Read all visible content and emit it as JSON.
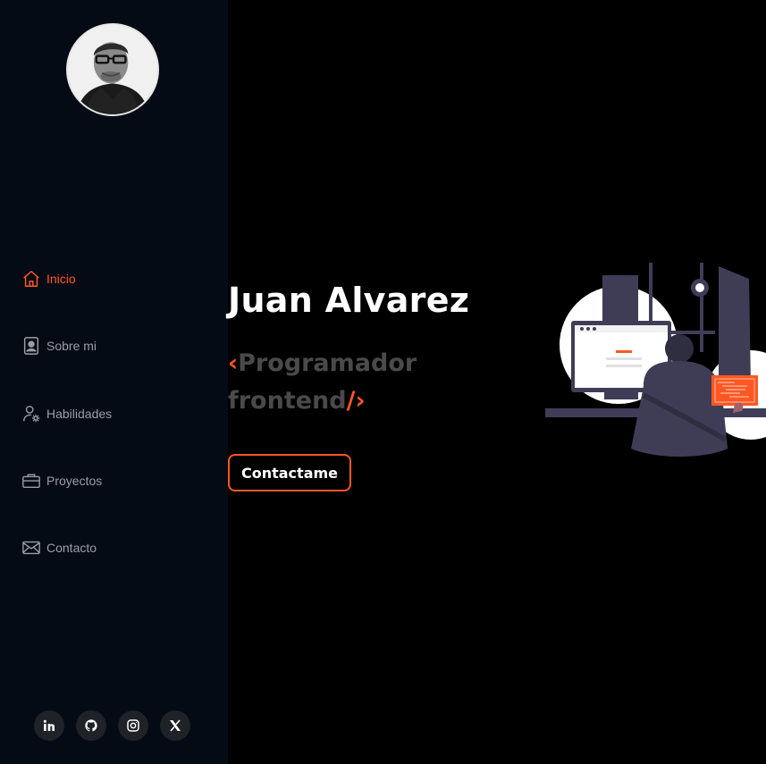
{
  "profile": {
    "avatar_alt": "Juan Alvarez"
  },
  "nav": {
    "items": [
      {
        "label": "Inicio",
        "icon": "home-icon",
        "active": true
      },
      {
        "label": "Sobre mi",
        "icon": "contact-card-icon",
        "active": false
      },
      {
        "label": "Habilidades",
        "icon": "user-gear-icon",
        "active": false
      },
      {
        "label": "Proyectos",
        "icon": "briefcase-icon",
        "active": false
      },
      {
        "label": "Contacto",
        "icon": "envelope-icon",
        "active": false
      }
    ]
  },
  "hero": {
    "name": "Juan Alvarez",
    "role_open": "‹",
    "role_text": "Programador frontend",
    "role_slash": "/",
    "role_close": "›",
    "cta_label": "Contactame"
  },
  "socials": [
    {
      "name": "LinkedIn",
      "icon": "linkedin-icon"
    },
    {
      "name": "GitHub",
      "icon": "github-icon"
    },
    {
      "name": "Instagram",
      "icon": "instagram-icon"
    },
    {
      "name": "X",
      "icon": "x-icon"
    }
  ],
  "colors": {
    "accent": "#ff5722",
    "sidebar_bg": "#050b14",
    "page_bg": "#000000",
    "muted_text": "#9a9ea6"
  }
}
